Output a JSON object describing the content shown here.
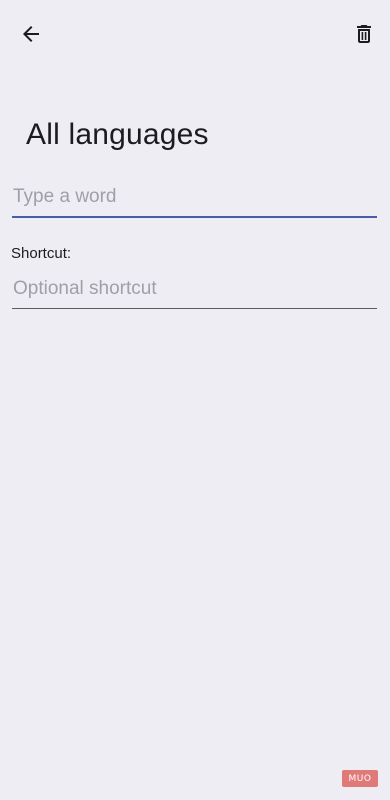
{
  "toolbar": {
    "back_icon": "arrow-left-icon",
    "delete_icon": "trash-icon"
  },
  "page": {
    "title": "All languages"
  },
  "word_field": {
    "value": "",
    "placeholder": "Type a word"
  },
  "shortcut_field": {
    "label": "Shortcut:",
    "value": "",
    "placeholder": "Optional shortcut"
  },
  "watermark": {
    "text": "MUO"
  },
  "colors": {
    "background": "#eeedf3",
    "accent_underline": "#4a5ea8",
    "placeholder": "#a09fa8",
    "watermark": "#e07a78"
  }
}
